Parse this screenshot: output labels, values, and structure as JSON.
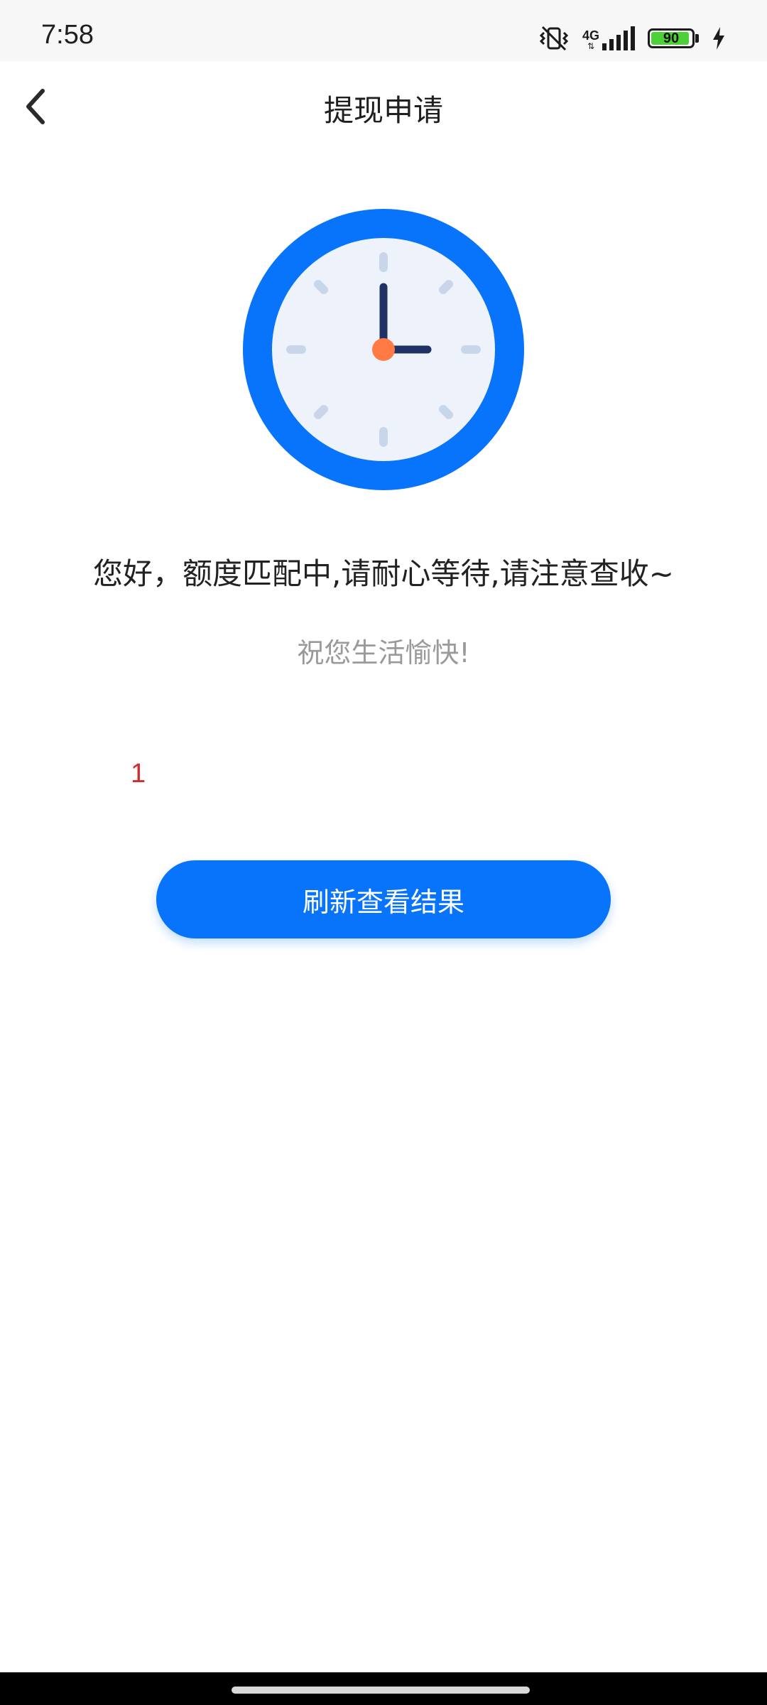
{
  "status_bar": {
    "time": "7:58",
    "network": "4G",
    "battery_level": "90",
    "icons": [
      "vibrate-off-icon",
      "signal-4g-icon",
      "battery-icon",
      "charging-icon"
    ]
  },
  "nav": {
    "title": "提现申请",
    "back_icon": "back-arrow-icon"
  },
  "illustration": {
    "icon": "clock-icon",
    "colors": {
      "ring": "#0873fb",
      "face": "#eef3fb",
      "hands": "#1f3263",
      "center": "#ff7a45",
      "ticks": "#c9d6ea"
    }
  },
  "content": {
    "message": "您好，额度匹配中,请耐心等待,请注意查收~",
    "wish": "祝您生活愉快!",
    "counter": "1"
  },
  "actions": {
    "refresh_label": "刷新查看结果"
  },
  "colors": {
    "accent": "#0873fb",
    "counter": "#d32b2b"
  }
}
